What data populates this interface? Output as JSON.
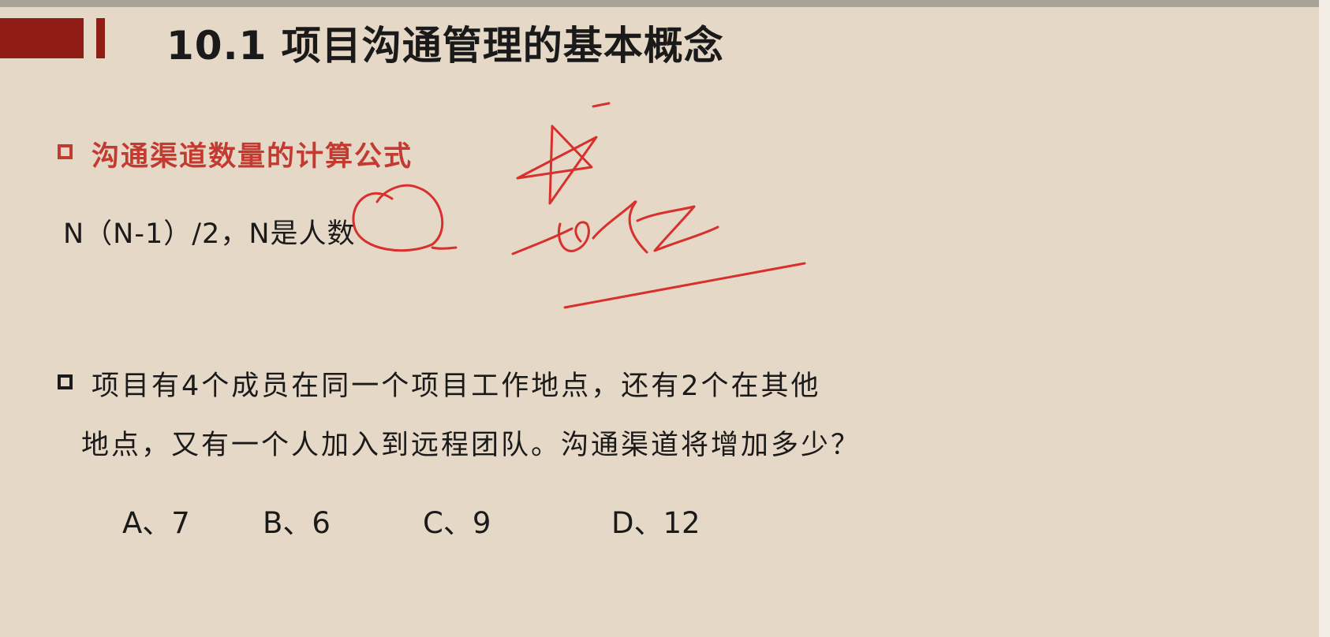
{
  "slide": {
    "title": "10.1 项目沟通管理的基本概念"
  },
  "section": {
    "heading": "沟通渠道数量的计算公式",
    "formula": "N（N-1）/2，N是人数"
  },
  "question": {
    "line1": "项目有4个成员在同一个项目工作地点，还有2个在其他",
    "line2": "地点，又有一个人加入到远程团队。沟通渠道将增加多少？",
    "options": [
      {
        "text": "A、7"
      },
      {
        "text": "B、6"
      },
      {
        "text": "C、9"
      },
      {
        "text": "D、12"
      }
    ]
  },
  "colors": {
    "accent_bar": "#8f1d15",
    "heading_red": "#c23a30",
    "annotation_ink": "#d8302c",
    "background": "#e6d8c6"
  }
}
